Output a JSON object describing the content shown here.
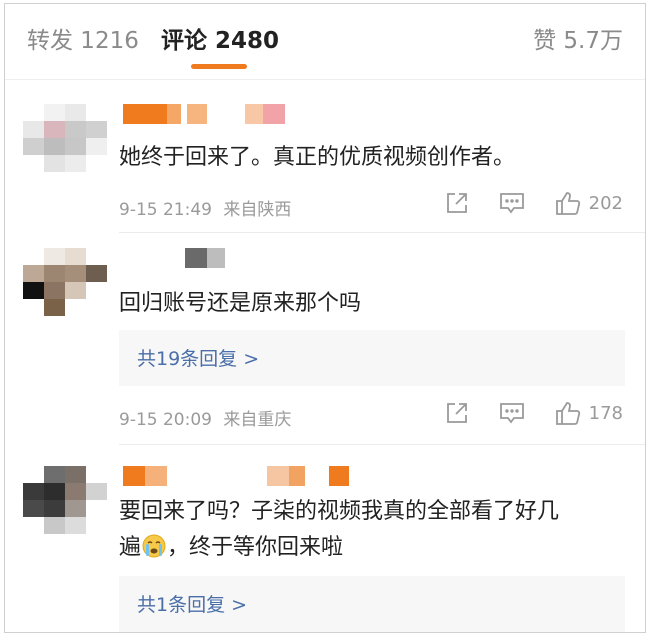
{
  "tabs": {
    "repost": "转发 1216",
    "comment": "评论 2480",
    "like": "赞 5.7万"
  },
  "colors": {
    "accent": "#f07a1e",
    "link": "#4a6ea8",
    "meta": "#9a9a9a"
  },
  "comments": [
    {
      "text": "她终于回来了。真正的优质视频创作者。",
      "time": "9-15 21:49",
      "source": "来自陕西",
      "likes": "202",
      "icons": [
        "share-icon",
        "comment-icon",
        "like-icon"
      ]
    },
    {
      "text": "回归账号还是原来那个吗",
      "replies": "共19条回复 >",
      "time": "9-15 20:09",
      "source": "来自重庆",
      "likes": "178",
      "icons": [
        "share-icon",
        "comment-icon",
        "like-icon"
      ]
    },
    {
      "text_line1": "要回来了吗？子柒的视频我真的全部看了好几",
      "text_line2a": "遍",
      "text_line2b": "，终于等你回来啦",
      "emoji": "crying-emoji",
      "replies": "共1条回复 >"
    }
  ]
}
